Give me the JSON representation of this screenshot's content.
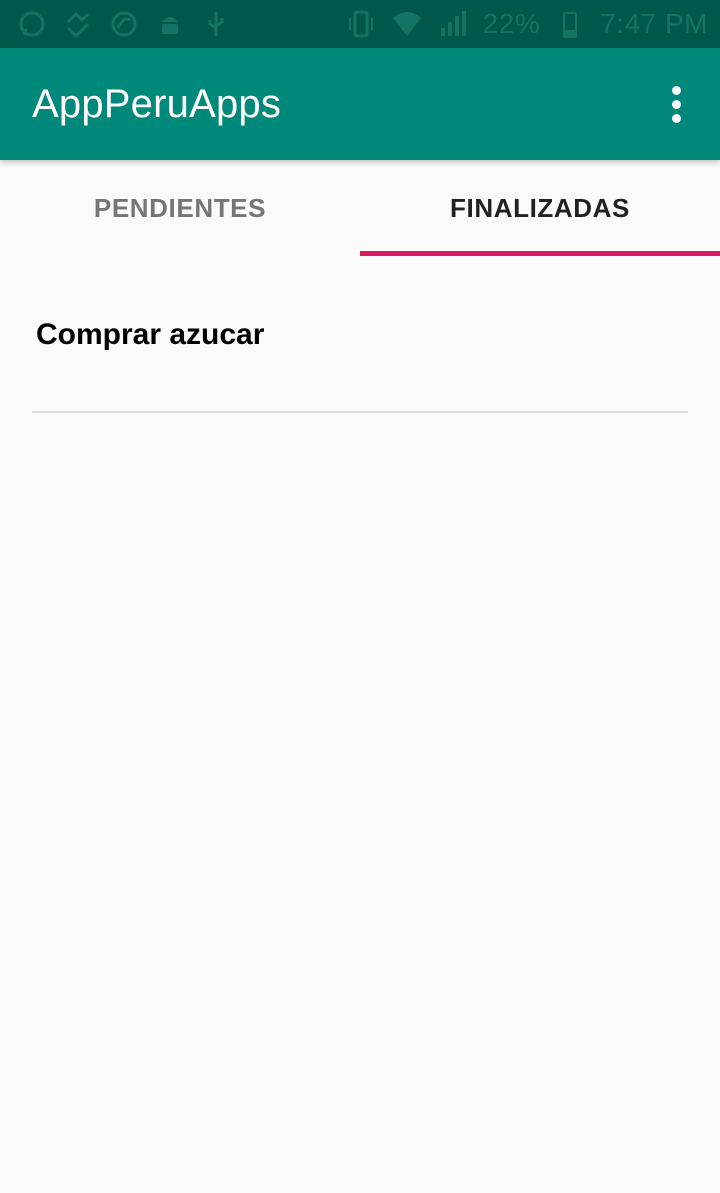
{
  "status_bar": {
    "left_icons": [
      "whatsapp-icon",
      "fit-icon",
      "sync-icon",
      "android-icon",
      "usb-icon"
    ],
    "right_icons": [
      "vibrate-icon",
      "wifi-icon",
      "signal-icon"
    ],
    "battery": "22%",
    "time": "7:47 PM"
  },
  "app_bar": {
    "title": "AppPeruApps",
    "overflow_icon": "more-vert-icon"
  },
  "tabs": [
    {
      "label": "PENDIENTES",
      "active": false
    },
    {
      "label": "FINALIZADAS",
      "active": true
    }
  ],
  "colors": {
    "status_bar": "#00574b",
    "app_bar": "#00897b",
    "tab_indicator": "#d81b60",
    "background": "#fafafa"
  },
  "list": {
    "items": [
      {
        "title": "Comprar azucar"
      }
    ]
  }
}
